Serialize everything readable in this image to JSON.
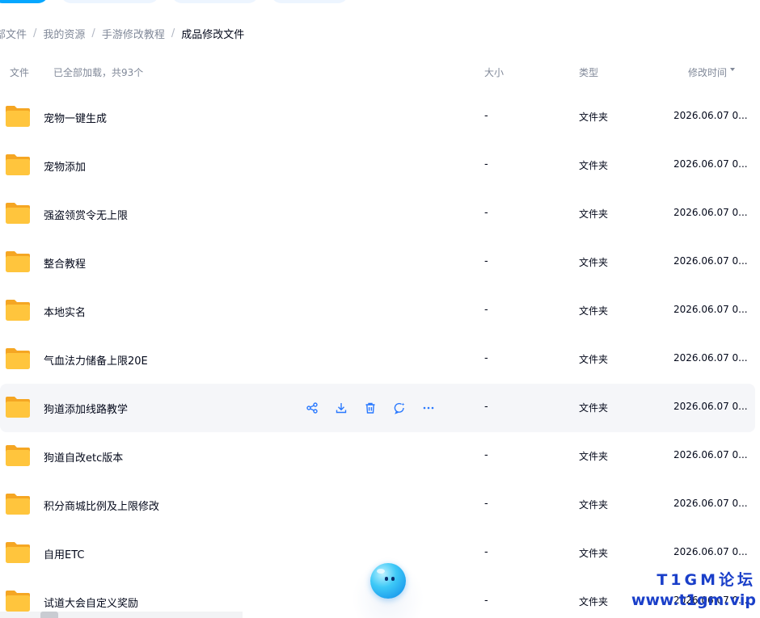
{
  "breadcrumb": [
    {
      "label": "部文件",
      "current": false
    },
    {
      "label": "我的资源",
      "current": false
    },
    {
      "label": "手游修改教程",
      "current": false
    },
    {
      "label": "成品修改文件",
      "current": true
    }
  ],
  "breadcrumb_separator": "/",
  "header": {
    "name": "文件",
    "count": "已全部加载，共93个",
    "size": "大小",
    "type": "类型",
    "mtime": "修改时间"
  },
  "files": [
    {
      "name": "宠物一键生成",
      "size": "-",
      "type": "文件夹",
      "mtime": "2026.06.07 0..."
    },
    {
      "name": "宠物添加",
      "size": "-",
      "type": "文件夹",
      "mtime": "2026.06.07 0..."
    },
    {
      "name": "强盗领赏令无上限",
      "size": "-",
      "type": "文件夹",
      "mtime": "2026.06.07 0..."
    },
    {
      "name": "整合教程",
      "size": "-",
      "type": "文件夹",
      "mtime": "2026.06.07 0..."
    },
    {
      "name": "本地实名",
      "size": "-",
      "type": "文件夹",
      "mtime": "2026.06.07 0..."
    },
    {
      "name": "气血法力储备上限20E",
      "size": "-",
      "type": "文件夹",
      "mtime": "2026.06.07 0..."
    },
    {
      "name": "狗道添加线路教学",
      "size": "-",
      "type": "文件夹",
      "mtime": "2026.06.07 0...",
      "hovered": true
    },
    {
      "name": "狗道自改etc版本",
      "size": "-",
      "type": "文件夹",
      "mtime": "2026.06.07 0..."
    },
    {
      "name": "积分商城比例及上限修改",
      "size": "-",
      "type": "文件夹",
      "mtime": "2026.06.07 0..."
    },
    {
      "name": "自用ETC",
      "size": "-",
      "type": "文件夹",
      "mtime": "2026.06.07 0..."
    },
    {
      "name": "试道大会自定义奖励",
      "size": "-",
      "type": "文件夹",
      "mtime": "2026.06.07 0..."
    }
  ],
  "row_actions": [
    "share-icon",
    "download-icon",
    "delete-icon",
    "ai-chat-icon",
    "more-icon"
  ],
  "watermark": {
    "line1": "T1GM论坛",
    "line2": "www.t1gm.vip"
  },
  "colors": {
    "accent": "#06a7ff",
    "folder": "#ffc53d",
    "folder_dark": "#f5a623",
    "text": "#03081a",
    "muted": "#818999",
    "hover_bg": "#f5f6f9",
    "action_icon": "#2878ff",
    "watermark": "#1a3fc9"
  }
}
